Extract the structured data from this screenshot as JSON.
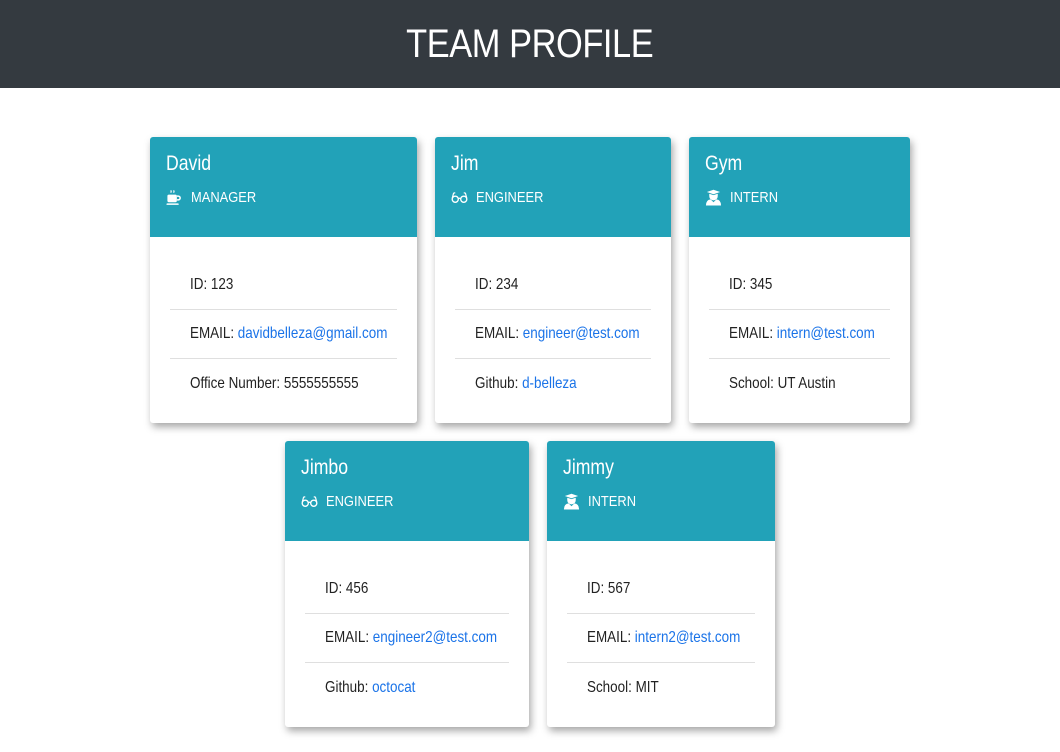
{
  "header": {
    "title": "TEAM PROFILE"
  },
  "cards": [
    {
      "name": "David",
      "role": "MANAGER",
      "role_icon": "coffee-mug-icon",
      "id": "ID: 123",
      "email_label": "EMAIL: ",
      "email": "davidbelleza@gmail.com",
      "extra_label": "Office Number: ",
      "extra_value": "5555555555"
    },
    {
      "name": "Jim",
      "role": "ENGINEER",
      "role_icon": "glasses-icon",
      "id": "ID: 234",
      "email_label": "EMAIL: ",
      "email": "engineer@test.com",
      "extra_label": "Github: ",
      "extra_value": "d-belleza"
    },
    {
      "name": "Gym",
      "role": "INTERN",
      "role_icon": "graduate-icon",
      "id": "ID: 345",
      "email_label": "EMAIL: ",
      "email": "intern@test.com",
      "extra_label": "School: ",
      "extra_value": "UT Austin"
    },
    {
      "name": "Jimbo",
      "role": "ENGINEER",
      "role_icon": "glasses-icon",
      "id": "ID: 456",
      "email_label": "EMAIL: ",
      "email": "engineer2@test.com",
      "extra_label": "Github: ",
      "extra_value": "octocat"
    },
    {
      "name": "Jimmy",
      "role": "INTERN",
      "role_icon": "graduate-icon",
      "id": "ID: 567",
      "email_label": "EMAIL: ",
      "email": "intern2@test.com",
      "extra_label": "School: ",
      "extra_value": "MIT"
    }
  ],
  "colors": {
    "header_bg": "#343a40",
    "card_head_bg": "#22a2b8",
    "link": "#1a73e8"
  }
}
